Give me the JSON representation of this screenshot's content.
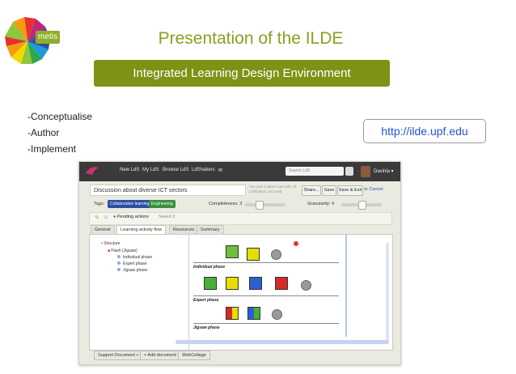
{
  "slide": {
    "logo_text": "metis",
    "title": "Presentation of the ILDE",
    "subtitle": "Integrated Learning Design Environment",
    "bullets": [
      "-Conceptualise",
      "-Author",
      "-Implement"
    ],
    "url": "http://ilde.upf.edu"
  },
  "app": {
    "nav": [
      "New LdS",
      "My LdS",
      "Browse LdS",
      "LdShakers"
    ],
    "search_placeholder": "Search LdS",
    "user_name": "Davinia",
    "lds_title": "Discussion about diverse ICT sectors",
    "warning": "You and 2 others can edit. All LdShakers can read",
    "buttons": {
      "share": "Share...",
      "save": "Save",
      "save_exit": "Save & Exit",
      "or": "or",
      "cancel": "Cancel"
    },
    "tags_label": "Tags:",
    "tags": [
      {
        "label": "Collaborative learning",
        "color": "#2c4fa3"
      },
      {
        "label": "Engineering",
        "color": "#3a8f3a"
      }
    ],
    "completeness_label": "Completeness:",
    "completeness_value": "3",
    "granularity_label": "Granularity:",
    "granularity_value": "4",
    "pending_actions": "Pending actions",
    "saved": "Saved 3",
    "tabs": [
      "General",
      "Learning activity flow",
      "Resources",
      "Summary"
    ],
    "active_tab": "Learning activity flow",
    "tree": {
      "root": "Structure",
      "child": "Flash (Jigsaw)",
      "phases": [
        "Individual phase",
        "Expert phase",
        "Jigsaw phase"
      ]
    },
    "lanes": [
      "Individual phase",
      "Expert phase",
      "Jigsaw phase"
    ],
    "bottom_buttons": [
      "Support Document »",
      "+ Add document",
      "WebCollage"
    ]
  },
  "colors": {
    "accent_green": "#7f9216",
    "title_green": "#8aa01e",
    "link_blue": "#2453c8"
  }
}
